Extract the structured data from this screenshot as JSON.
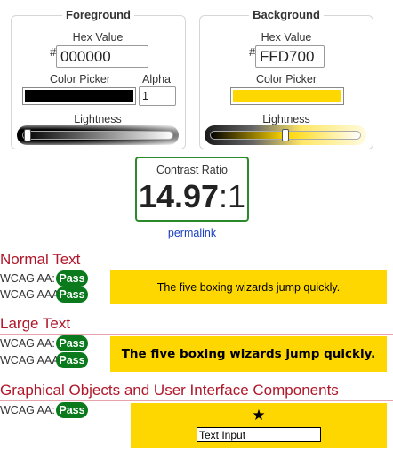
{
  "foreground": {
    "title": "Foreground",
    "hex_label": "Hex Value",
    "hash": "#",
    "hex_value": "000000",
    "color_picker_label": "Color Picker",
    "alpha_label": "Alpha",
    "alpha_value": "1",
    "lightness_label": "Lightness",
    "color": "#000000",
    "lightness_percent": 0
  },
  "background": {
    "title": "Background",
    "hex_label": "Hex Value",
    "hash": "#",
    "hex_value": "FFD700",
    "color_picker_label": "Color Picker",
    "lightness_label": "Lightness",
    "color": "#FFD700",
    "lightness_percent": 50
  },
  "contrast": {
    "label": "Contrast Ratio",
    "ratio_bold": "14.97",
    "ratio_suffix": ":1",
    "permalink": "permalink"
  },
  "normal_text": {
    "heading": "Normal Text",
    "aa_label": "WCAG AA:",
    "aa_result": "Pass",
    "aaa_label": "WCAG AAA:",
    "aaa_result": "Pass",
    "sample": "The five boxing wizards jump quickly."
  },
  "large_text": {
    "heading": "Large Text",
    "aa_label": "WCAG AA:",
    "aa_result": "Pass",
    "aaa_label": "WCAG AAA:",
    "aaa_result": "Pass",
    "sample": "The five boxing wizards jump quickly."
  },
  "graphical": {
    "heading": "Graphical Objects and User Interface Components",
    "aa_label": "WCAG AA:",
    "aa_result": "Pass",
    "star_icon": "star-icon",
    "star": "★",
    "text_input_value": "Text Input"
  },
  "colors": {
    "pass": "#0a7a1c",
    "heading": "#b0172a",
    "link": "#1a3fbf"
  }
}
